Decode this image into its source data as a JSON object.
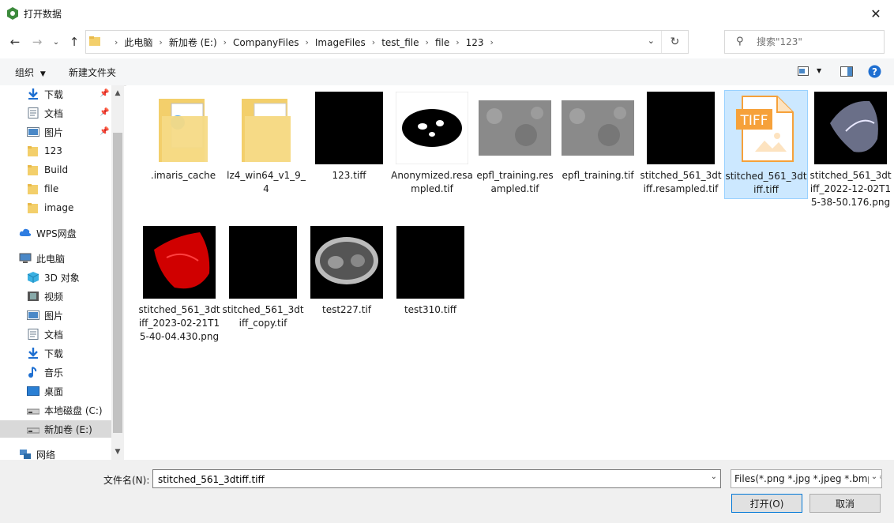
{
  "window": {
    "title": "打开数据"
  },
  "address": {
    "crumbs": [
      "此电脑",
      "新加卷 (E:)",
      "CompanyFiles",
      "ImageFiles",
      "test_file",
      "file",
      "123"
    ]
  },
  "search": {
    "placeholder": "搜索\"123\""
  },
  "toolbar": {
    "organize": "组织",
    "new_folder": "新建文件夹"
  },
  "sidebar": {
    "items": [
      {
        "label": "下载",
        "icon": "download-icon"
      },
      {
        "label": "文档",
        "icon": "document-icon"
      },
      {
        "label": "图片",
        "icon": "picture-icon"
      },
      {
        "label": "123",
        "icon": "folder-icon"
      },
      {
        "label": "Build",
        "icon": "folder-icon"
      },
      {
        "label": "file",
        "icon": "folder-icon"
      },
      {
        "label": "image",
        "icon": "folder-icon"
      },
      {
        "label": "WPS网盘",
        "icon": "cloud-icon"
      },
      {
        "label": "此电脑",
        "icon": "computer-icon"
      },
      {
        "label": "3D 对象",
        "icon": "cube-icon"
      },
      {
        "label": "视频",
        "icon": "video-icon"
      },
      {
        "label": "图片",
        "icon": "picture-icon"
      },
      {
        "label": "文档",
        "icon": "document-icon"
      },
      {
        "label": "下载",
        "icon": "download-icon"
      },
      {
        "label": "音乐",
        "icon": "music-icon"
      },
      {
        "label": "桌面",
        "icon": "desktop-icon"
      },
      {
        "label": "本地磁盘 (C:)",
        "icon": "drive-icon"
      },
      {
        "label": "新加卷 (E:)",
        "icon": "drive-icon"
      },
      {
        "label": "网络",
        "icon": "network-icon"
      }
    ]
  },
  "files": [
    {
      "name": ".imaris_cache",
      "kind": "folder-doc"
    },
    {
      "name": "lz4_win64_v1_9_4",
      "kind": "folder"
    },
    {
      "name": "123.tiff",
      "kind": "black"
    },
    {
      "name": "Anonymized.resampled.tif",
      "kind": "ct-mask"
    },
    {
      "name": "epfl_training.resampled.tif",
      "kind": "gray"
    },
    {
      "name": "epfl_training.tif",
      "kind": "gray"
    },
    {
      "name": "stitched_561_3dtiff.resampled.tif",
      "kind": "black"
    },
    {
      "name": "stitched_561_3dtiff.tiff",
      "kind": "tiff-icon",
      "selected": true
    },
    {
      "name": "stitched_561_3dtiff_2022-12-02T15-38-50.176.png",
      "kind": "white-cloud"
    },
    {
      "name": "stitched_561_3dtiff_2023-02-21T15-40-04.430.png",
      "kind": "red-cloud"
    },
    {
      "name": "stitched_561_3dtiff_copy.tif",
      "kind": "black"
    },
    {
      "name": "test227.tif",
      "kind": "ct-scan"
    },
    {
      "name": "test310.tiff",
      "kind": "black"
    }
  ],
  "bottom": {
    "filename_label": "文件名(N):",
    "filename_value": "stitched_561_3dtiff.tiff",
    "filetype": "Files(*.png *.jpg *.jpeg *.bmp *.tif *.tiff)",
    "open": "打开(O)",
    "cancel": "取消"
  },
  "colors": {
    "selection": "#cce8ff",
    "accent": "#0078d7",
    "folder": "#f3cf6b",
    "tiff_orange": "#f6a13a"
  }
}
